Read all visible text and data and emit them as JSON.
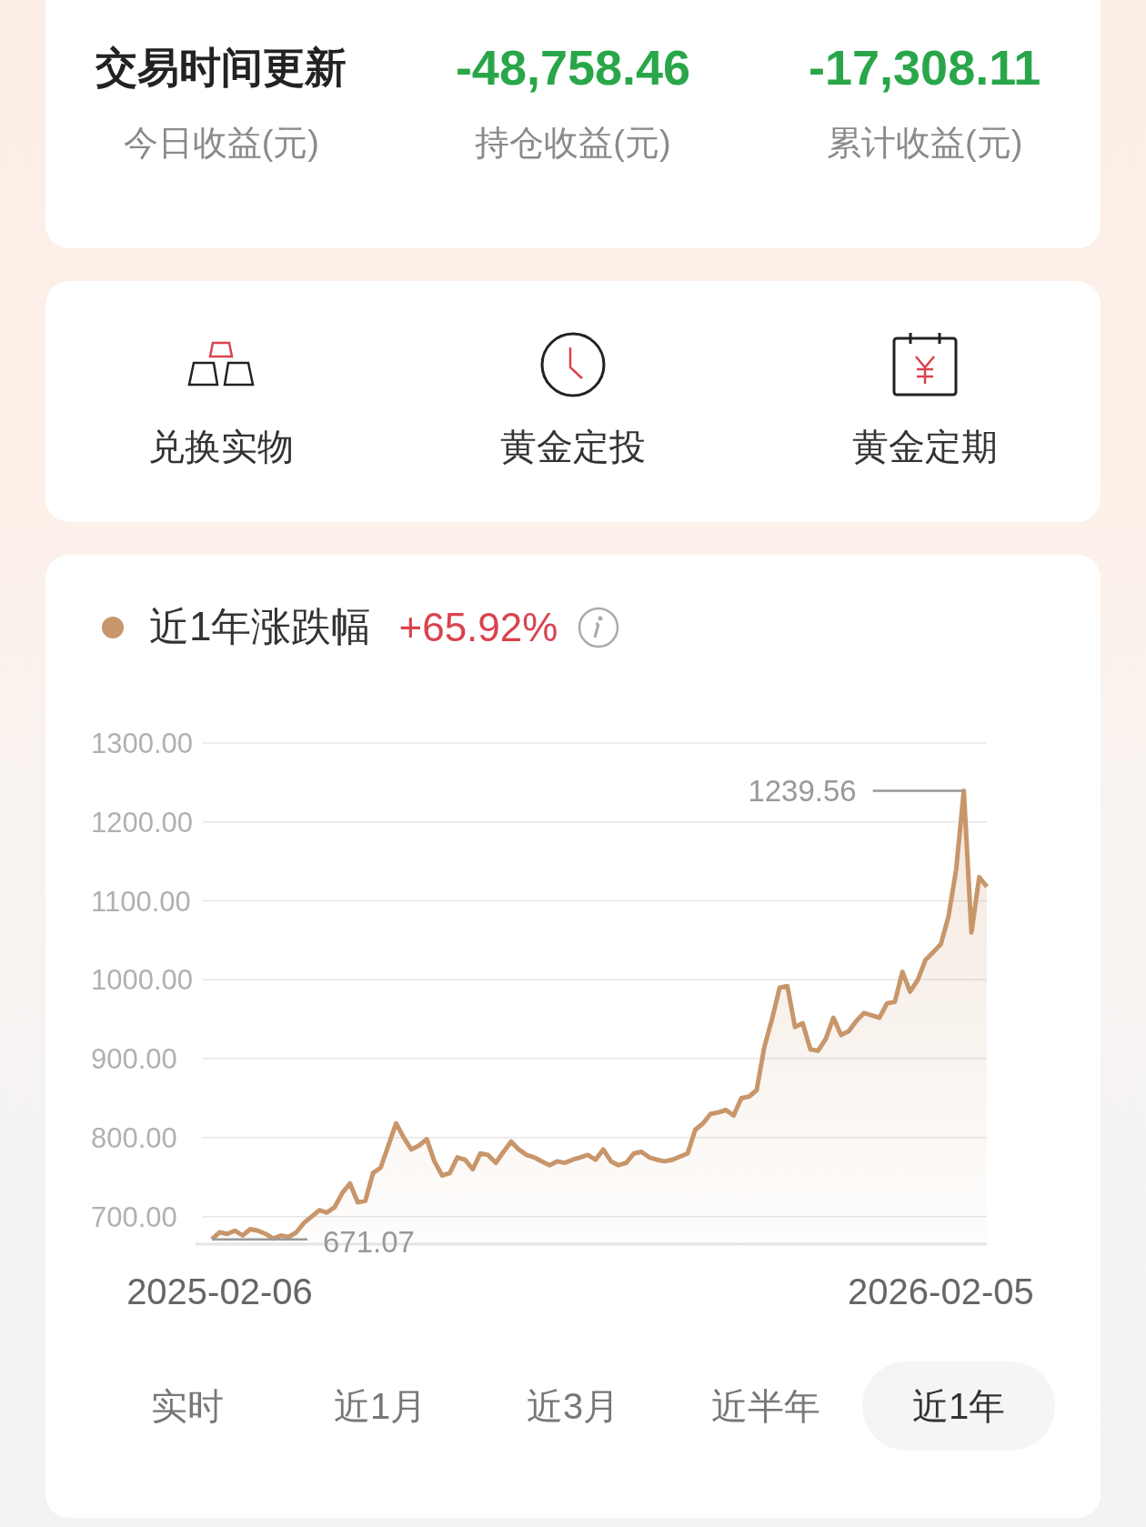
{
  "summary": [
    {
      "value": "交易时间更新",
      "kind": "status",
      "label": "今日收益(元)"
    },
    {
      "value": "-48,758.46",
      "kind": "loss",
      "label": "持仓收益(元)"
    },
    {
      "value": "-17,308.11",
      "kind": "loss",
      "label": "累计收益(元)"
    }
  ],
  "shortcuts": [
    {
      "label": "兑换实物",
      "kind": "bars"
    },
    {
      "label": "黄金定投",
      "kind": "clock"
    },
    {
      "label": "黄金定期",
      "kind": "calendar"
    }
  ],
  "performance": {
    "change": "+65.92%",
    "chart_data": {
      "type": "area",
      "grid": true,
      "categories": [
        null,
        "2025-02-06",
        null,
        null,
        null,
        null,
        null,
        null,
        null,
        null,
        null,
        null,
        null,
        null,
        null,
        null,
        null,
        null,
        null,
        null,
        null,
        null,
        null,
        null,
        null,
        null,
        null,
        null,
        null,
        null,
        null,
        null,
        null,
        null,
        null,
        null,
        null,
        null,
        null,
        null,
        null,
        null,
        null,
        null,
        null,
        null,
        null,
        null,
        null,
        null,
        null,
        null,
        null,
        null,
        null,
        null,
        null,
        null,
        null,
        null,
        null,
        null,
        null,
        null,
        null,
        null,
        null,
        null,
        null,
        null,
        null,
        null,
        null,
        null,
        null,
        null,
        null,
        null,
        null,
        null,
        null,
        null,
        null,
        null,
        null,
        null,
        null,
        null,
        null,
        null,
        null,
        null,
        null,
        null,
        null,
        "2026-02-05",
        null,
        null,
        null,
        null,
        null,
        null
      ],
      "ylim": [
        665,
        1300
      ],
      "yticks": [
        {
          "value": 1300,
          "label": "1300.00"
        },
        {
          "value": 1200,
          "label": "1200.00"
        },
        {
          "value": 1100,
          "label": "1100.00"
        },
        {
          "value": 1000,
          "label": "1000.00"
        },
        {
          "value": 900,
          "label": "900.00"
        },
        {
          "value": 800,
          "label": "800.00"
        },
        {
          "value": 700,
          "label": "700.00"
        }
      ],
      "series": [
        {
          "name": "近1年涨跌幅",
          "color": "#c8966a",
          "values": [
            671.07,
            680,
            678,
            682,
            676,
            684,
            682,
            678,
            672,
            676,
            674,
            680,
            692,
            700,
            708,
            705,
            712,
            730,
            742,
            718,
            720,
            755,
            762,
            790,
            818,
            800,
            785,
            790,
            798,
            770,
            752,
            755,
            775,
            772,
            760,
            780,
            778,
            768,
            782,
            795,
            785,
            778,
            775,
            770,
            765,
            770,
            768,
            772,
            775,
            778,
            772,
            785,
            770,
            765,
            768,
            780,
            782,
            775,
            772,
            770,
            772,
            776,
            780,
            810,
            818,
            830,
            832,
            835,
            828,
            850,
            852,
            860,
            915,
            950,
            990,
            992,
            940,
            945,
            912,
            910,
            925,
            952,
            930,
            935,
            948,
            958,
            955,
            952,
            970,
            972,
            1010,
            985,
            1000,
            1025,
            1035,
            1045,
            1080,
            1140,
            1239.56,
            1060,
            1130,
            1118
          ]
        }
      ],
      "annotations": [
        "1239.56",
        "671.07"
      ]
    }
  },
  "periods": [
    {
      "label": "实时",
      "selected": false
    },
    {
      "label": "近1月",
      "selected": false
    },
    {
      "label": "近3月",
      "selected": false
    },
    {
      "label": "近半年",
      "selected": false
    },
    {
      "label": "近1年",
      "selected": true
    }
  ]
}
